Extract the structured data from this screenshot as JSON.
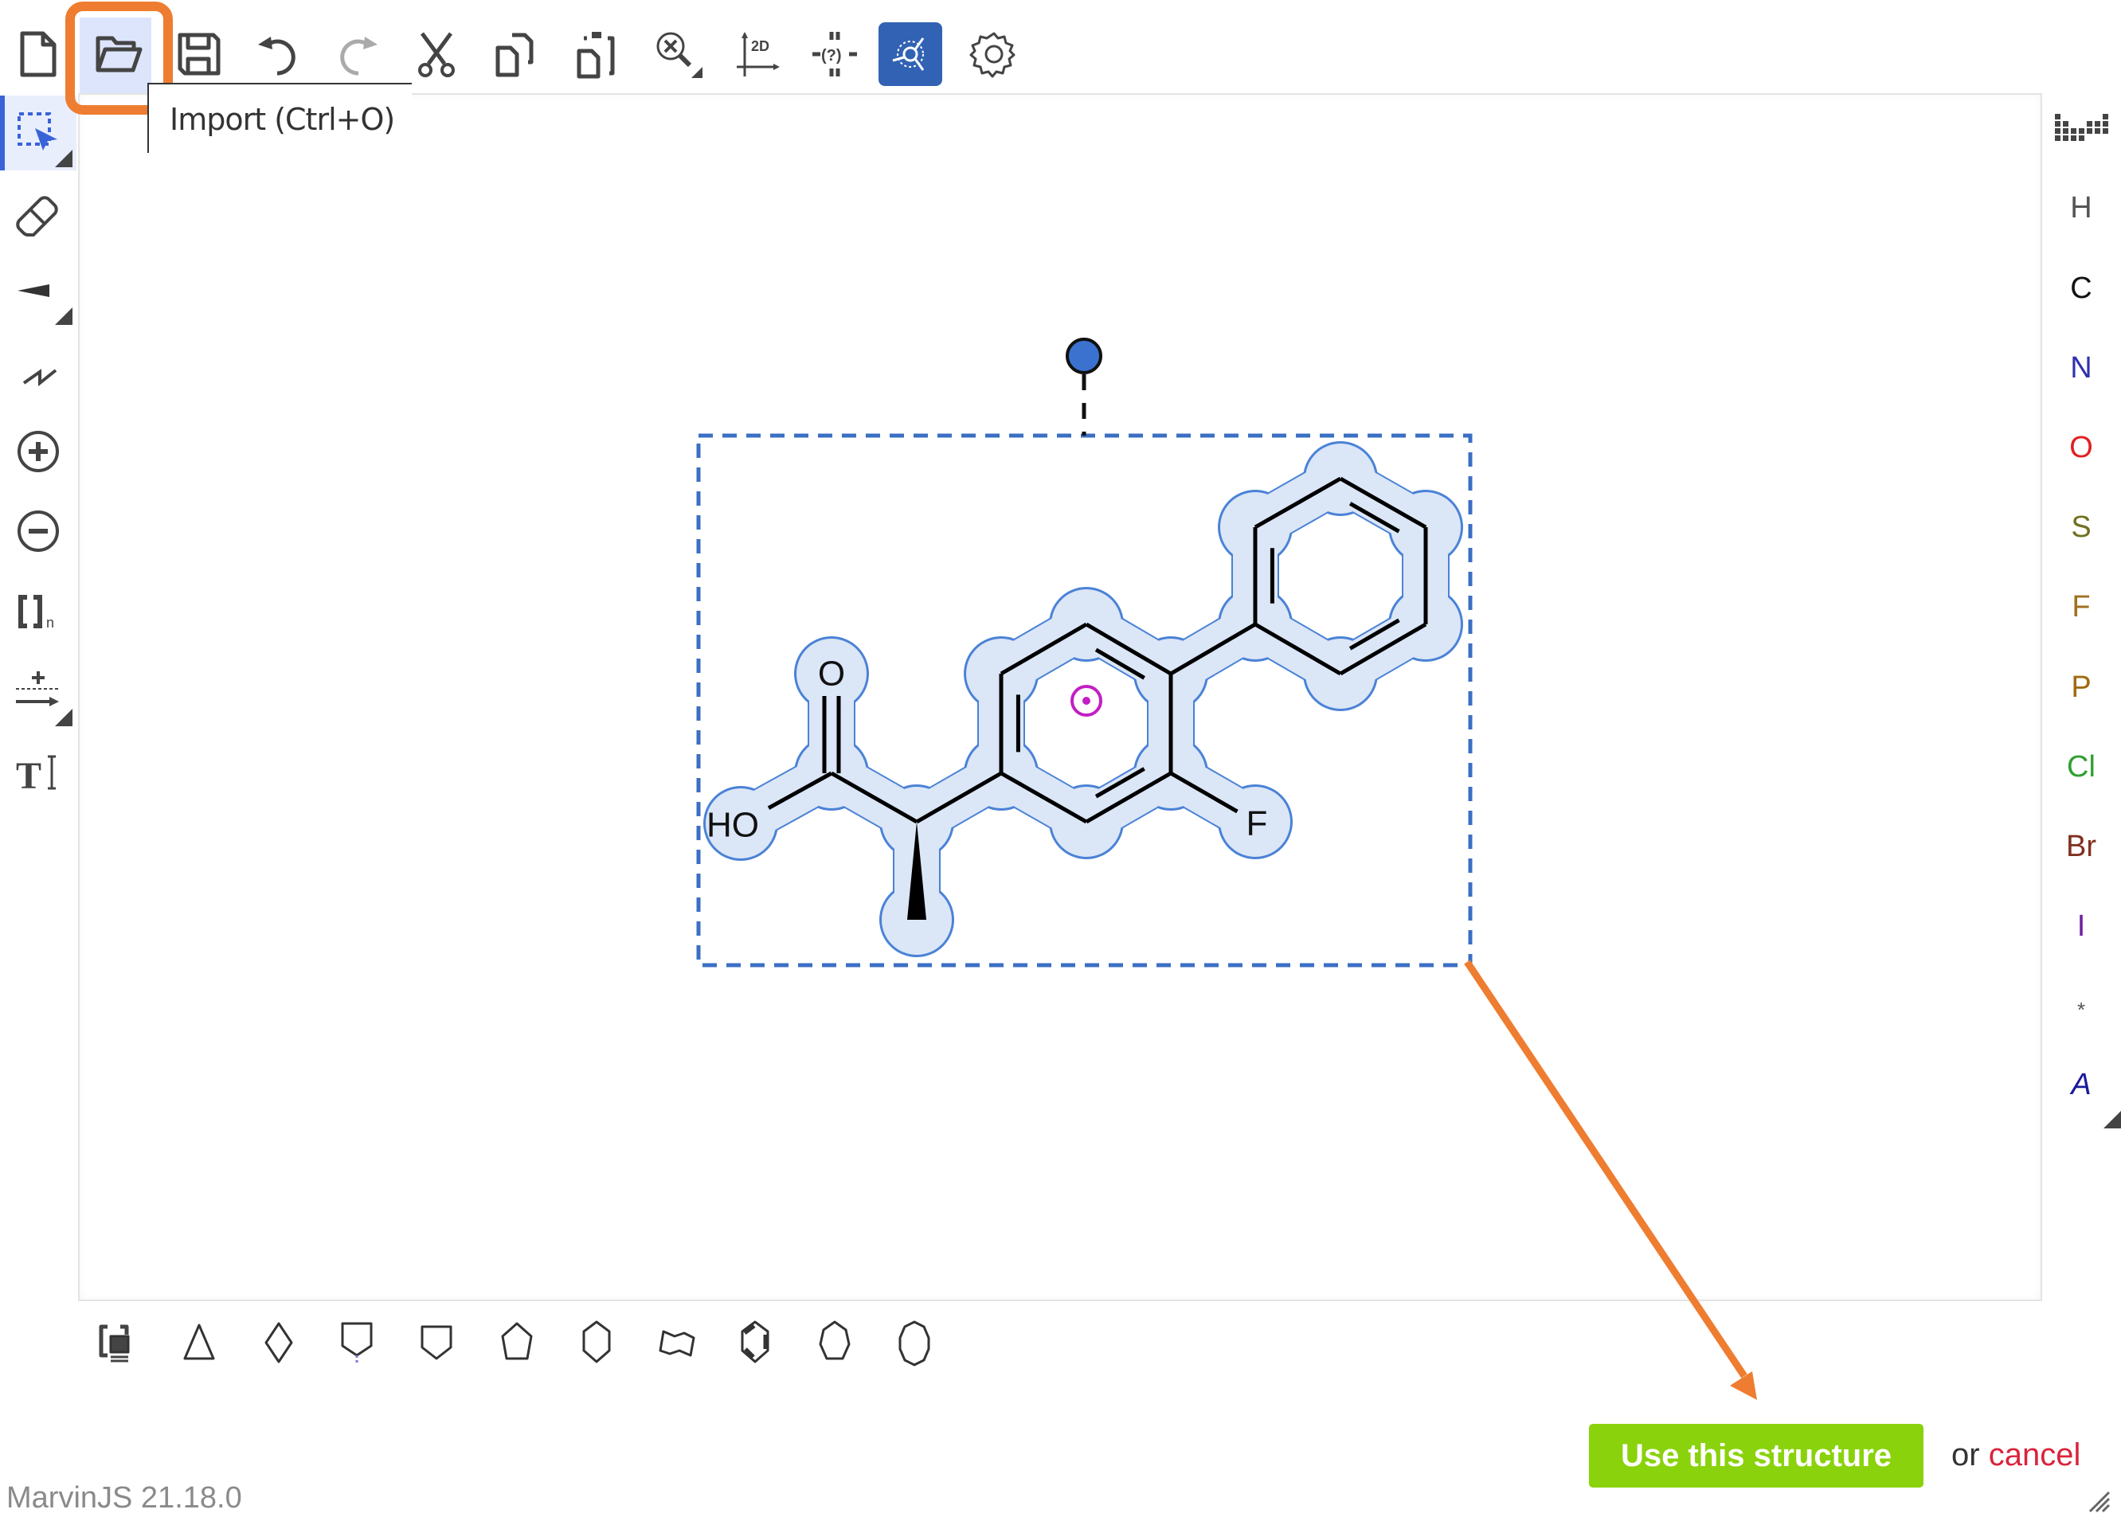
{
  "app": {
    "name": "MarvinJS",
    "version_label": "MarvinJS 21.18.0"
  },
  "top_toolbar": {
    "items": [
      {
        "name": "new-document",
        "icon": "new-document-icon"
      },
      {
        "name": "import",
        "icon": "folder-open-icon",
        "highlighted": true
      },
      {
        "name": "save",
        "icon": "save-icon"
      },
      {
        "name": "undo",
        "icon": "undo-icon"
      },
      {
        "name": "redo",
        "icon": "redo-icon",
        "disabled": true
      },
      {
        "name": "cut",
        "icon": "scissors-icon"
      },
      {
        "name": "copy",
        "icon": "copy-icon"
      },
      {
        "name": "paste",
        "icon": "paste-icon"
      },
      {
        "name": "zoom",
        "icon": "zoom-icon"
      },
      {
        "name": "clean-2d",
        "icon": "clean-2d-icon",
        "label": "2D"
      },
      {
        "name": "query",
        "icon": "query-icon",
        "label": "(?)"
      },
      {
        "name": "cpk",
        "icon": "cpk-icon",
        "active": true
      },
      {
        "name": "settings",
        "icon": "gear-icon"
      }
    ],
    "tooltip": "Import (Ctrl+O)"
  },
  "left_toolbar": {
    "items": [
      {
        "name": "select",
        "icon": "selection-icon",
        "active": true
      },
      {
        "name": "erase",
        "icon": "eraser-icon"
      },
      {
        "name": "bond",
        "icon": "wedge-bond-icon"
      },
      {
        "name": "chain",
        "icon": "chain-icon"
      },
      {
        "name": "charge-plus",
        "icon": "plus-circle-icon"
      },
      {
        "name": "charge-minus",
        "icon": "minus-circle-icon"
      },
      {
        "name": "sgroup",
        "icon": "bracket-icon",
        "label": "[]",
        "sub": "n"
      },
      {
        "name": "reaction",
        "icon": "reaction-arrow-icon"
      },
      {
        "name": "text",
        "icon": "text-icon",
        "label": "T"
      }
    ]
  },
  "right_toolbar": {
    "items": [
      {
        "symbol": "",
        "name": "periodic-table",
        "color": "#444444"
      },
      {
        "symbol": "H",
        "color": "#555555"
      },
      {
        "symbol": "C",
        "color": "#111111"
      },
      {
        "symbol": "N",
        "color": "#3030b0"
      },
      {
        "symbol": "O",
        "color": "#e02020"
      },
      {
        "symbol": "S",
        "color": "#707020"
      },
      {
        "symbol": "F",
        "color": "#a07020"
      },
      {
        "symbol": "P",
        "color": "#a06a10"
      },
      {
        "symbol": "Cl",
        "color": "#30a030"
      },
      {
        "symbol": "Br",
        "color": "#803020"
      },
      {
        "symbol": "I",
        "color": "#7020a0"
      },
      {
        "symbol": "*",
        "color": "#555555"
      },
      {
        "symbol": "A",
        "color": "#1a1a9c"
      }
    ]
  },
  "bottom_toolbar": {
    "items": [
      "template-library",
      "cyclopropane",
      "cyclobutane",
      "cyclopentane-sugar",
      "cyclopentane",
      "cyclopentane-alt",
      "cyclohexane",
      "cyclohexane-chair",
      "benzene",
      "cycloheptane",
      "cyclooctane"
    ]
  },
  "molecule": {
    "name": "flurbiprofen",
    "atom_labels": {
      "carbonyl_o": "O",
      "hydroxyl": "HO",
      "fluorine": "F"
    }
  },
  "actions": {
    "use_label": "Use this structure",
    "or_label": "or",
    "cancel_label": "cancel"
  },
  "colors": {
    "accent": "#3b6fc4",
    "highlight": "#dbe6f7",
    "orange": "#ee7d31",
    "use_button": "#8ad20c",
    "cancel": "#d9243c"
  }
}
